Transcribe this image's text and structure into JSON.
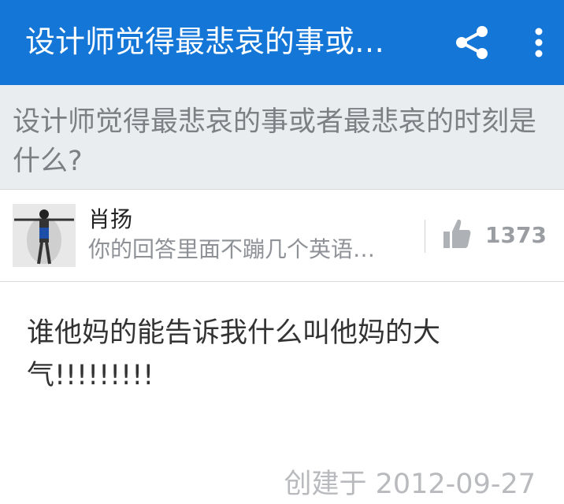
{
  "appbar": {
    "title": "设计师觉得最悲哀的事或…",
    "share_icon": "share-icon",
    "more_icon": "more-vert-icon",
    "color": "#1476d7"
  },
  "question": {
    "text": "设计师觉得最悲哀的事或者最悲哀的时刻是什么?"
  },
  "author": {
    "name": "肖扬",
    "bio": "你的回答里面不蹦几个英语…",
    "vote_icon": "thumb-up-icon",
    "vote_count": "1373"
  },
  "answer": {
    "body": "谁他妈的能告诉我什么叫他妈的大气!!!!!!!!!",
    "created": "创建于 2012-09-27"
  }
}
